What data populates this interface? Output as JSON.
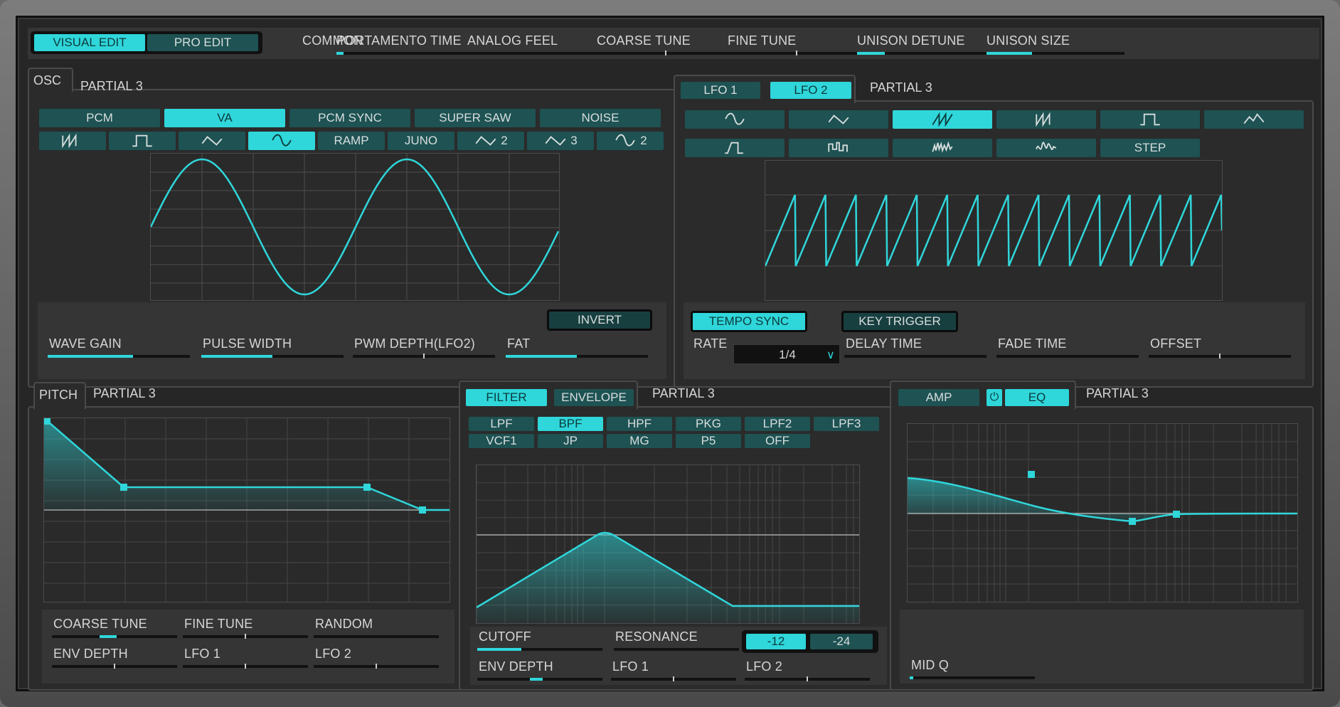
{
  "top": {
    "visual_edit": "VISUAL EDIT",
    "pro_edit": "PRO EDIT",
    "common": "COMMON",
    "params": [
      {
        "label": "PORTAMENTO TIME",
        "value": 0.05
      },
      {
        "label": "ANALOG FEEL",
        "value": 0
      },
      {
        "label": "COARSE TUNE",
        "value": 0.5
      },
      {
        "label": "FINE TUNE",
        "value": 0.5
      },
      {
        "label": "UNISON DETUNE",
        "value": 0.2
      },
      {
        "label": "UNISON SIZE",
        "value": 0.33
      }
    ]
  },
  "osc": {
    "tab": "OSC",
    "partial": "PARTIAL 3",
    "types": [
      "PCM",
      "VA",
      "PCM SYNC",
      "SUPER SAW",
      "NOISE"
    ],
    "selected_type": "VA",
    "waves": [
      {
        "icon": "saw-down-icon",
        "text": ""
      },
      {
        "icon": "square-wave-icon",
        "text": ""
      },
      {
        "icon": "triangle-wave-icon",
        "text": ""
      },
      {
        "icon": "sine-wave-icon",
        "text": ""
      },
      {
        "icon": "",
        "text": "RAMP"
      },
      {
        "icon": "",
        "text": "JUNO"
      },
      {
        "icon": "triangle-wave-icon",
        "text": "2"
      },
      {
        "icon": "triangle-wave-icon",
        "text": "3"
      },
      {
        "icon": "sine-wave-icon",
        "text": "2"
      }
    ],
    "selected_wave": 3,
    "invert": "INVERT",
    "params": [
      {
        "label": "WAVE GAIN",
        "value": 0.6
      },
      {
        "label": "PULSE WIDTH",
        "value": 0.5
      },
      {
        "label": "PWM DEPTH(LFO2)",
        "value": 0.5
      },
      {
        "label": "FAT",
        "value": 0.5
      }
    ]
  },
  "lfo": {
    "tabs": [
      "LFO 1",
      "LFO 2"
    ],
    "selected_tab": "LFO 2",
    "partial": "PARTIAL 3",
    "shapes_row1": [
      "sine-wave-icon",
      "triangle-wave-icon",
      "saw-up-icon",
      "saw-down-icon",
      "square-wave-icon",
      "trapezoid-icon"
    ],
    "shapes_row2": [
      "ramp-rise-icon",
      "sample-hold-icon",
      "random-icon",
      "chaos-icon"
    ],
    "step": "STEP",
    "selected_shape": 2,
    "tempo_sync": "TEMPO SYNC",
    "key_trigger": "KEY TRIGGER",
    "rate_label": "RATE",
    "rate_value": "1/4",
    "params": [
      {
        "label": "DELAY TIME",
        "value": 0
      },
      {
        "label": "FADE TIME",
        "value": 0
      },
      {
        "label": "OFFSET",
        "value": 0.5
      }
    ]
  },
  "pitch": {
    "tab": "PITCH",
    "partial": "PARTIAL 3",
    "params": [
      {
        "label": "COARSE TUNE",
        "value": 0.5
      },
      {
        "label": "FINE TUNE",
        "value": 0.5
      },
      {
        "label": "RANDOM",
        "value": 0
      },
      {
        "label": "ENV DEPTH",
        "value": 0.5
      },
      {
        "label": "LFO 1",
        "value": 0.5
      },
      {
        "label": "LFO 2",
        "value": 0.5
      }
    ]
  },
  "filter": {
    "tabs": [
      "FILTER",
      "ENVELOPE"
    ],
    "selected_tab": "FILTER",
    "partial": "PARTIAL 3",
    "types_row1": [
      "LPF",
      "BPF",
      "HPF",
      "PKG",
      "LPF2",
      "LPF3"
    ],
    "types_row2": [
      "VCF1",
      "JP",
      "MG",
      "P5",
      "OFF"
    ],
    "selected_type": "BPF",
    "slope": [
      "-12",
      "-24"
    ],
    "selected_slope": "-12",
    "params": [
      {
        "label": "CUTOFF",
        "value": 0.35
      },
      {
        "label": "RESONANCE",
        "value": 0
      },
      {
        "label": "ENV DEPTH",
        "value": 0.5
      },
      {
        "label": "LFO 1",
        "value": 0.5
      },
      {
        "label": "LFO 2",
        "value": 0.5
      }
    ]
  },
  "amp": {
    "tabs": [
      "AMP",
      "EQ"
    ],
    "selected_tab": "EQ",
    "partial": "PARTIAL 3",
    "params": [
      {
        "label": "MID Q",
        "value": 0.03
      }
    ]
  },
  "colors": {
    "accent": "#2fd6da",
    "button": "#1e5253",
    "panel": "#2b2b2b"
  }
}
